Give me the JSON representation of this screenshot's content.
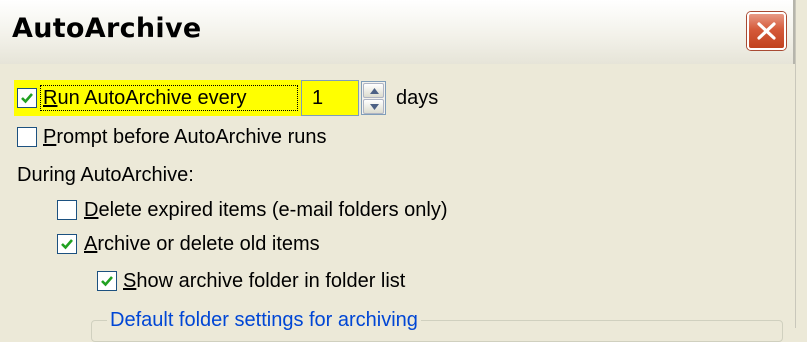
{
  "dialog": {
    "title": "AutoArchive"
  },
  "options": {
    "run_autoarchive": {
      "label_hotkey": "R",
      "label_rest": "un AutoArchive every",
      "checked": true
    },
    "days_value": "1",
    "days_unit": "days",
    "prompt_before": {
      "label_hotkey": "P",
      "label_rest": "rompt before AutoArchive runs",
      "checked": false
    }
  },
  "during_section": {
    "heading": "During AutoArchive:",
    "delete_expired": {
      "label_hotkey": "D",
      "label_rest": "elete expired items (e-mail folders only)",
      "checked": false
    },
    "archive_old": {
      "label_hotkey": "A",
      "label_rest": "rchive or delete old items",
      "checked": true
    },
    "show_archive_folder": {
      "label_hotkey": "S",
      "label_rest": "how archive folder in folder list",
      "checked": true
    }
  },
  "default_settings_group": {
    "label": "Default folder settings for archiving"
  },
  "colors": {
    "highlight": "#ffff00",
    "window_bg": "#ece9d8",
    "checkmark": "#21a121",
    "close_button": "#d55a3a",
    "group_label": "#0046d5"
  }
}
